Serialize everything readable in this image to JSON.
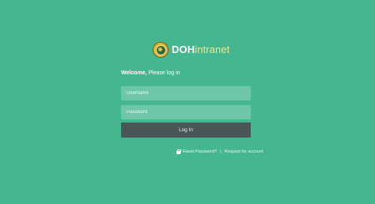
{
  "brand": {
    "part1": "DOH",
    "part2": "intranet",
    "seal_icon": "doh-seal-icon"
  },
  "welcome": {
    "strong": "Welcome,",
    "rest": " Please log in"
  },
  "form": {
    "username_placeholder": "Username",
    "password_placeholder": "Password",
    "login_label": "Log In"
  },
  "links": {
    "reset_label": "Reset Password?",
    "separator": "|",
    "request_label": "Request for account",
    "lock_icon": "lock-icon"
  },
  "colors": {
    "background": "#45b78f",
    "button": "#4a5758",
    "brand_accent": "#f4e58a"
  }
}
